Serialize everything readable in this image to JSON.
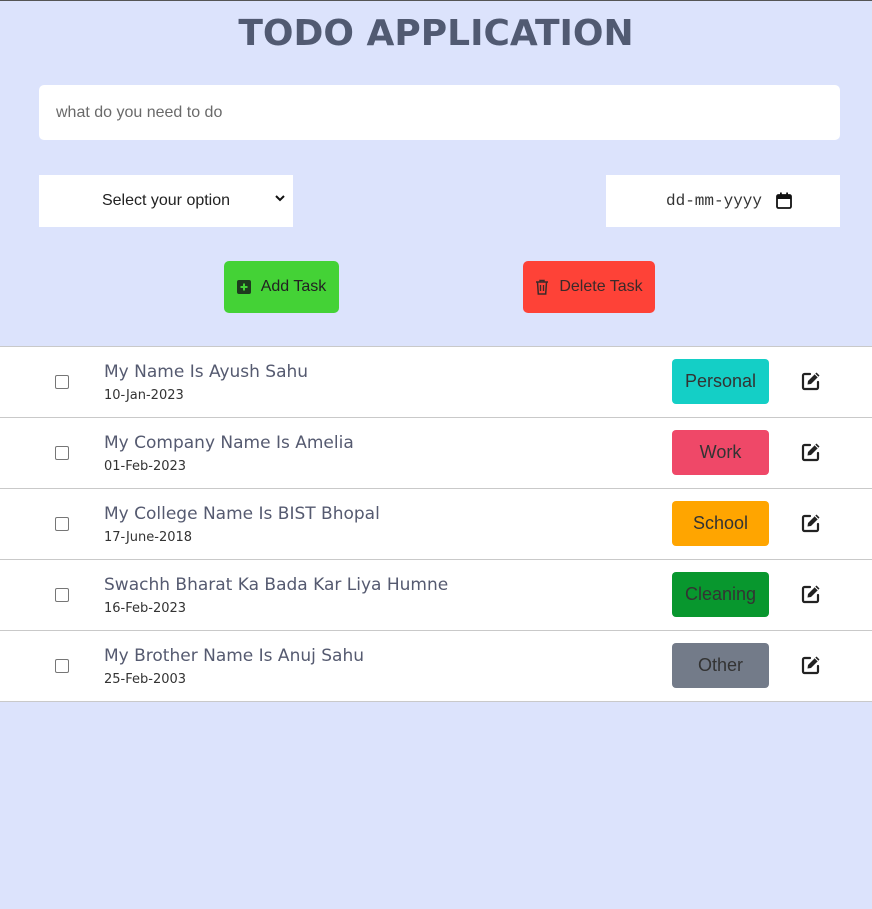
{
  "header": {
    "title": "TODO APPLICATION"
  },
  "form": {
    "task_placeholder": "what do you need to do",
    "category_select": "Select your option",
    "date_placeholder": "dd-mm-yyyy",
    "add_label": "Add Task",
    "delete_label": "Delete Task"
  },
  "colors": {
    "background": "#dce3fc",
    "add_button": "#44d236",
    "delete_button": "#fe4237"
  },
  "tasks": [
    {
      "name": "My Name Is Ayush Sahu",
      "date": "10-Jan-2023",
      "category": "Personal",
      "color": "#14cfc6",
      "checked": false,
      "edit_icon": "edit-icon"
    },
    {
      "name": "My Company Name Is Amelia",
      "date": "01-Feb-2023",
      "category": "Work",
      "color": "#ef4868",
      "checked": false,
      "edit_icon": "edit-icon"
    },
    {
      "name": "My College Name Is BIST Bhopal",
      "date": "17-June-2018",
      "category": "School",
      "color": "#ffa500",
      "checked": false,
      "edit_icon": "edit-icon"
    },
    {
      "name": "Swachh Bharat Ka Bada Kar Liya Humne",
      "date": "16-Feb-2023",
      "category": "Cleaning",
      "color": "#08972e",
      "checked": false,
      "edit_icon": "edit-icon"
    },
    {
      "name": "My Brother Name Is Anuj Sahu",
      "date": "25-Feb-2003",
      "category": "Other",
      "color": "#737b89",
      "checked": false,
      "edit_icon": "edit-icon"
    }
  ]
}
